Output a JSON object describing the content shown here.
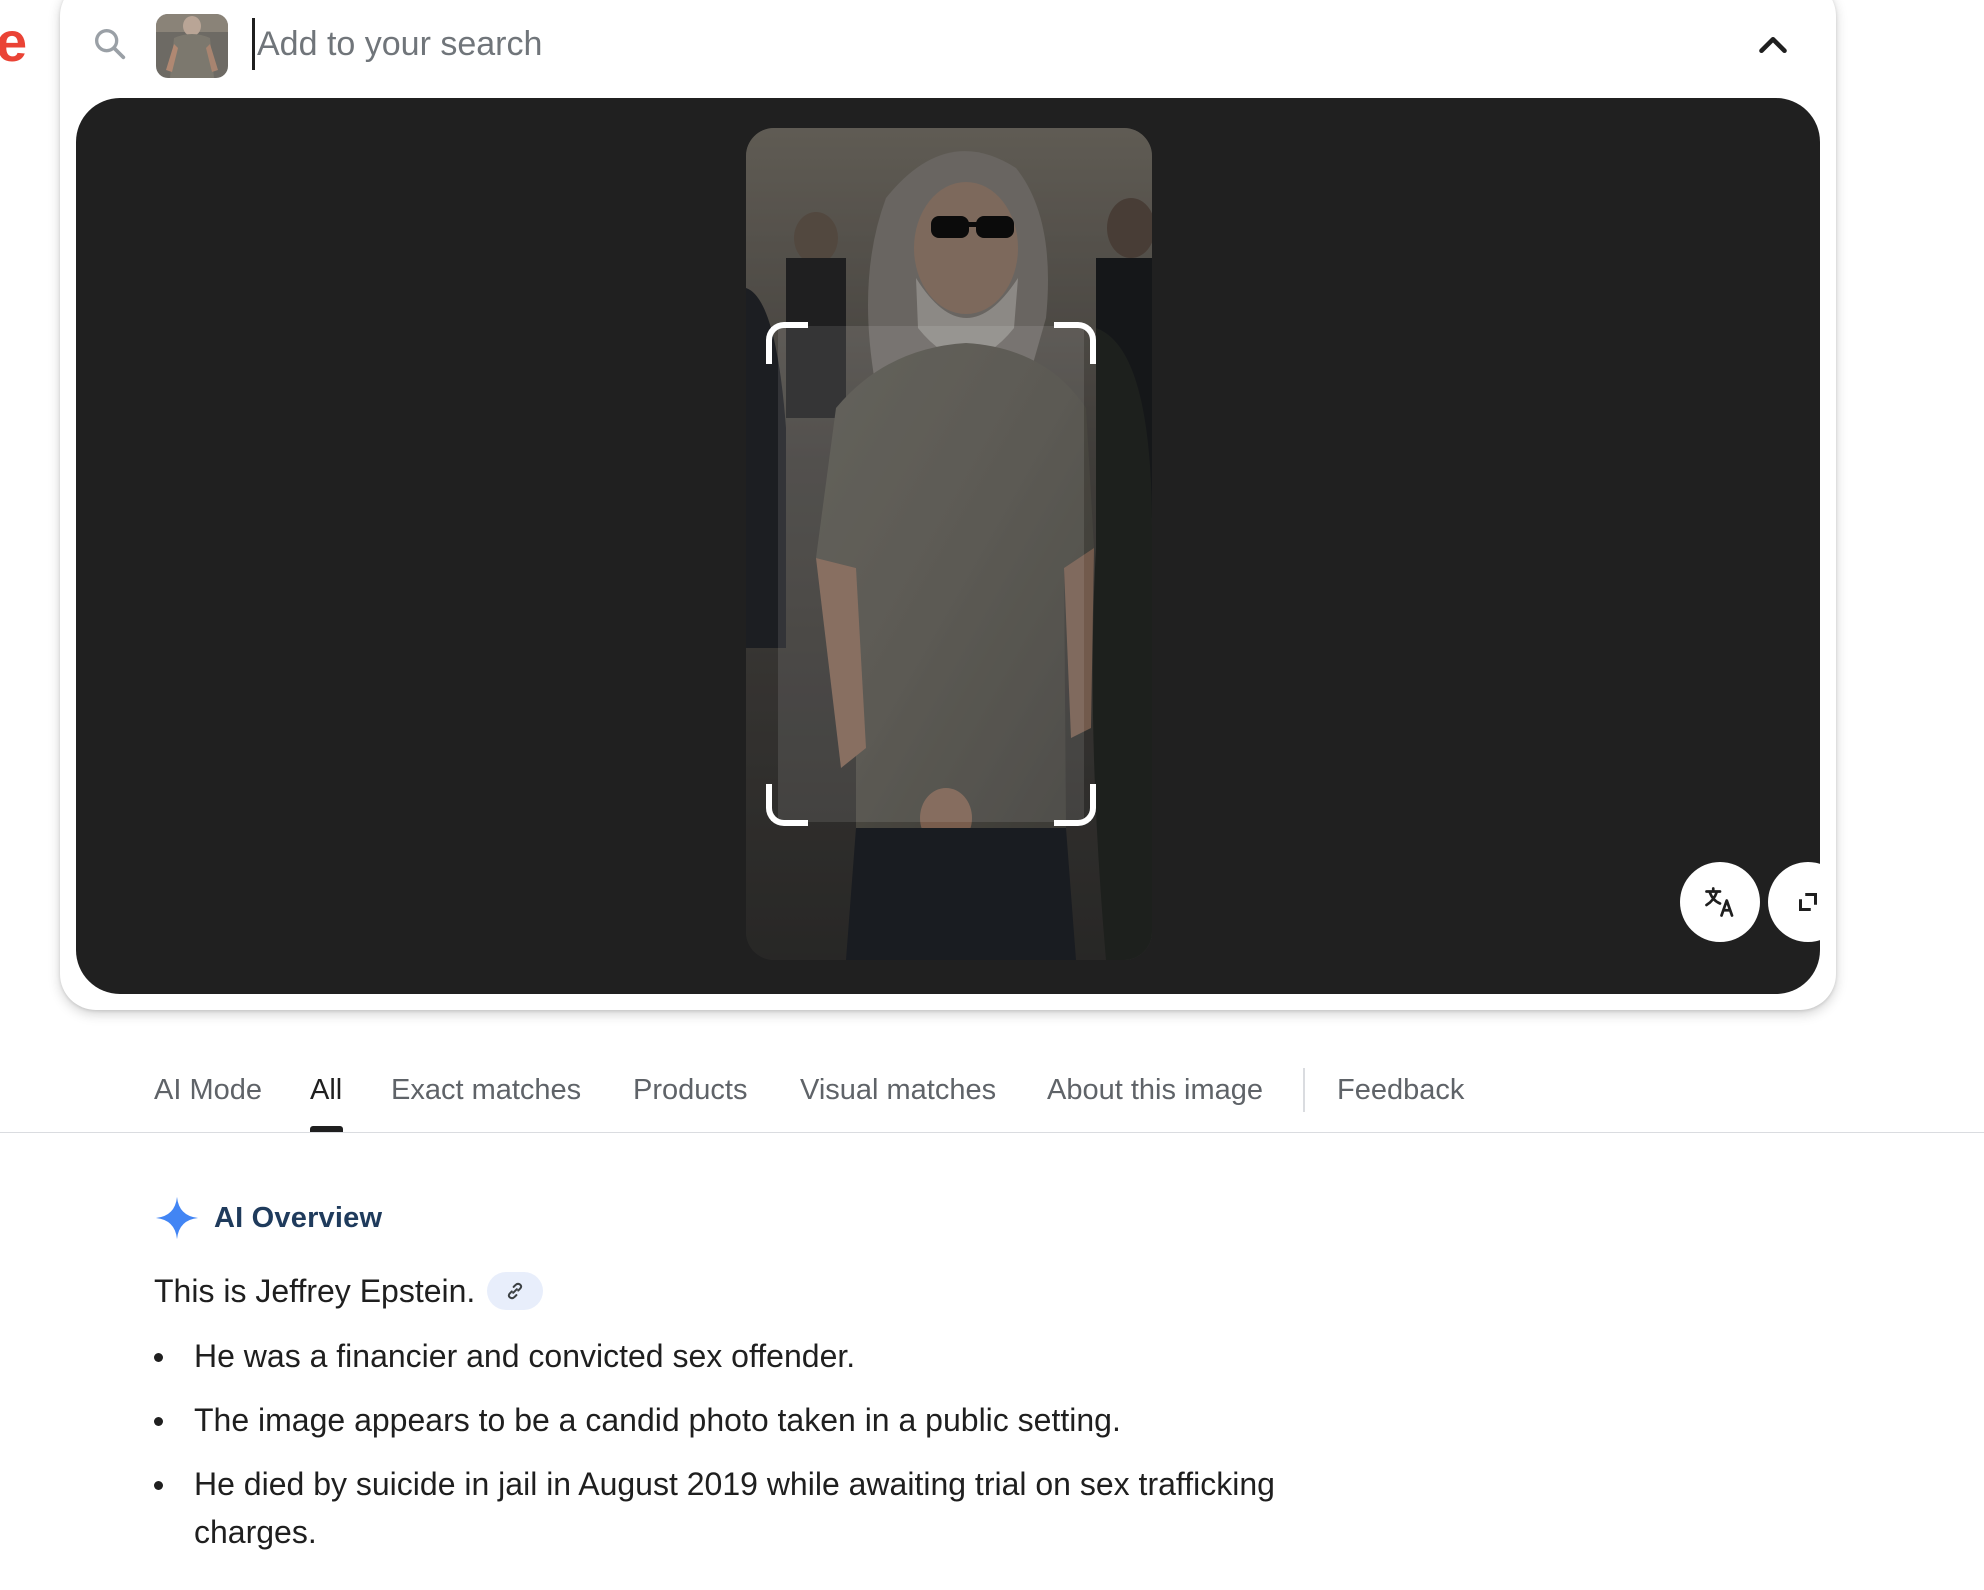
{
  "logo_fragment": "e",
  "search": {
    "placeholder": "Add to your search",
    "value": ""
  },
  "icons": {
    "search": "search-icon",
    "collapse": "chevron-up-icon",
    "translate": "translate-icon",
    "fullscreen": "fullscreen-icon",
    "ai_overview": "sparkle-icon",
    "source_link": "link-icon"
  },
  "tabs": [
    {
      "label": "AI Mode",
      "active": false
    },
    {
      "label": "All",
      "active": true
    },
    {
      "label": "Exact matches",
      "active": false
    },
    {
      "label": "Products",
      "active": false
    },
    {
      "label": "Visual matches",
      "active": false
    },
    {
      "label": "About this image",
      "active": false
    },
    {
      "label": "Feedback",
      "active": false
    }
  ],
  "ai_overview": {
    "title": "AI Overview",
    "lead": "This is Jeffrey Epstein.",
    "bullets": [
      "He was a financier and convicted sex offender.",
      "The image appears to be a candid photo taken in a public setting.",
      "He died by suicide in jail in August 2019 while awaiting trial on sex trafficking charges."
    ]
  },
  "colors": {
    "viewer_background": "#202020",
    "accent_blue": "#4285f4",
    "logo_red": "#ea4335",
    "link_chip": "#e8eefb"
  }
}
